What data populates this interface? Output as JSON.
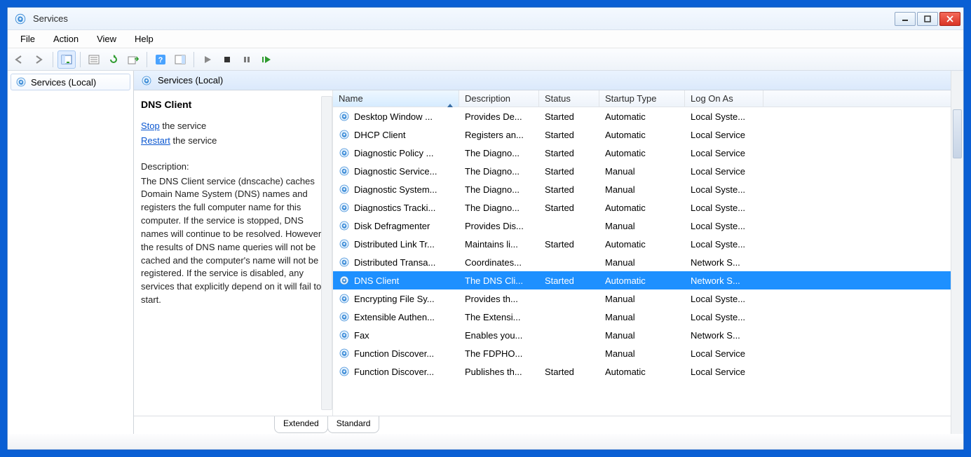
{
  "window": {
    "title": "Services"
  },
  "menu": {
    "file": "File",
    "action": "Action",
    "view": "View",
    "help": "Help"
  },
  "tree": {
    "root": "Services (Local)"
  },
  "pane_header": "Services (Local)",
  "detail": {
    "name": "DNS Client",
    "stop_link": "Stop",
    "stop_rest": " the service",
    "restart_link": "Restart",
    "restart_rest": " the service",
    "desc_label": "Description:",
    "desc": "The DNS Client service (dnscache) caches Domain Name System (DNS) names and registers the full computer name for this computer. If the service is stopped, DNS names will continue to be resolved. However, the results of DNS name queries will not be cached and the computer's name will not be registered. If the service is disabled, any services that explicitly depend on it will fail to start."
  },
  "columns": {
    "name": "Name",
    "description": "Description",
    "status": "Status",
    "startup": "Startup Type",
    "logon": "Log On As"
  },
  "tabs": {
    "extended": "Extended",
    "standard": "Standard"
  },
  "services": [
    {
      "name": "Desktop Window ...",
      "desc": "Provides De...",
      "status": "Started",
      "startup": "Automatic",
      "logon": "Local Syste..."
    },
    {
      "name": "DHCP Client",
      "desc": "Registers an...",
      "status": "Started",
      "startup": "Automatic",
      "logon": "Local Service"
    },
    {
      "name": "Diagnostic Policy ...",
      "desc": "The Diagno...",
      "status": "Started",
      "startup": "Automatic",
      "logon": "Local Service"
    },
    {
      "name": "Diagnostic Service...",
      "desc": "The Diagno...",
      "status": "Started",
      "startup": "Manual",
      "logon": "Local Service"
    },
    {
      "name": "Diagnostic System...",
      "desc": "The Diagno...",
      "status": "Started",
      "startup": "Manual",
      "logon": "Local Syste..."
    },
    {
      "name": "Diagnostics Tracki...",
      "desc": "The Diagno...",
      "status": "Started",
      "startup": "Automatic",
      "logon": "Local Syste..."
    },
    {
      "name": "Disk Defragmenter",
      "desc": "Provides Dis...",
      "status": "",
      "startup": "Manual",
      "logon": "Local Syste..."
    },
    {
      "name": "Distributed Link Tr...",
      "desc": "Maintains li...",
      "status": "Started",
      "startup": "Automatic",
      "logon": "Local Syste..."
    },
    {
      "name": "Distributed Transa...",
      "desc": "Coordinates...",
      "status": "",
      "startup": "Manual",
      "logon": "Network S..."
    },
    {
      "name": "DNS Client",
      "desc": "The DNS Cli...",
      "status": "Started",
      "startup": "Automatic",
      "logon": "Network S...",
      "selected": true
    },
    {
      "name": "Encrypting File Sy...",
      "desc": "Provides th...",
      "status": "",
      "startup": "Manual",
      "logon": "Local Syste..."
    },
    {
      "name": "Extensible Authen...",
      "desc": "The Extensi...",
      "status": "",
      "startup": "Manual",
      "logon": "Local Syste..."
    },
    {
      "name": "Fax",
      "desc": "Enables you...",
      "status": "",
      "startup": "Manual",
      "logon": "Network S..."
    },
    {
      "name": "Function Discover...",
      "desc": "The FDPHO...",
      "status": "",
      "startup": "Manual",
      "logon": "Local Service"
    },
    {
      "name": "Function Discover...",
      "desc": "Publishes th...",
      "status": "Started",
      "startup": "Automatic",
      "logon": "Local Service"
    }
  ]
}
